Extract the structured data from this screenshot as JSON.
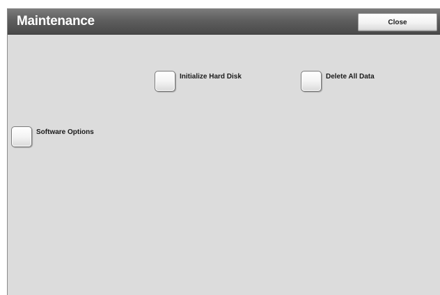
{
  "window": {
    "title": "Maintenance",
    "close_label": "Close"
  },
  "options": [
    {
      "label": "Initialize Hard Disk"
    },
    {
      "label": "Delete All Data"
    },
    {
      "label": "Software Options"
    }
  ]
}
